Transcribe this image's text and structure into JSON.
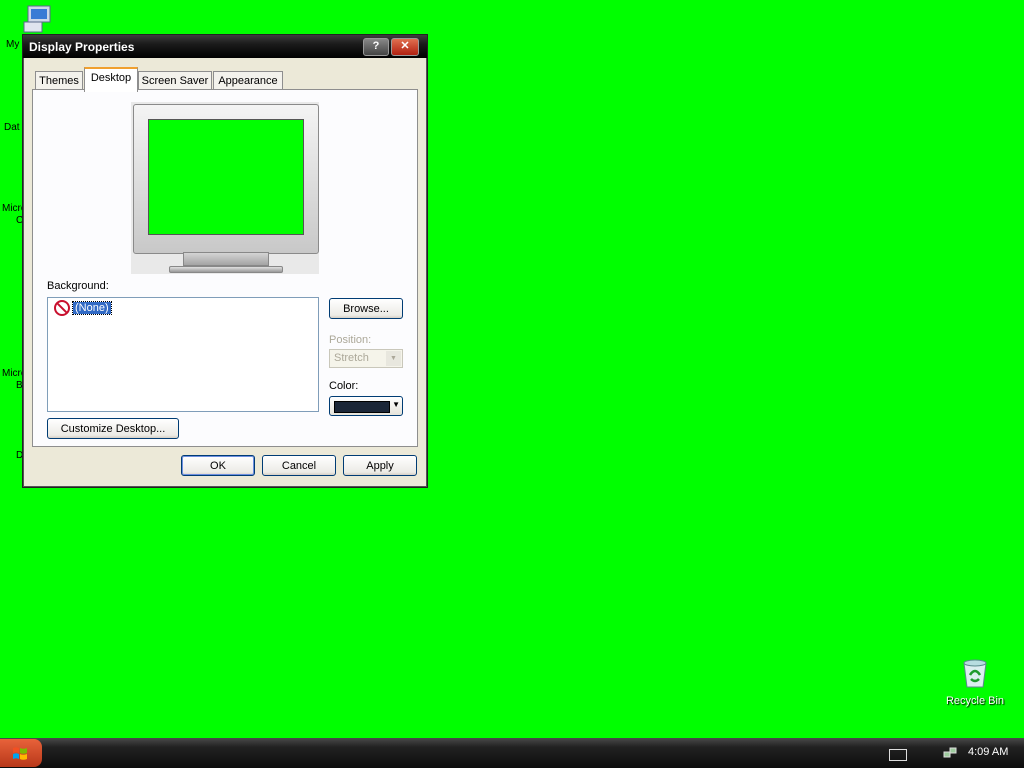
{
  "colors": {
    "desktop_bg": "#00ff00",
    "accent": "#316ac5",
    "swatch": "#1b2637"
  },
  "desktop": {
    "icon_fragments": [
      {
        "id": "my",
        "text": "My"
      },
      {
        "id": "dat",
        "text": "Dat"
      },
      {
        "id": "micr1",
        "text": "Micro"
      },
      {
        "id": "micr1b",
        "text": "C"
      },
      {
        "id": "micr2",
        "text": "Micro"
      },
      {
        "id": "micr2b",
        "text": "B"
      },
      {
        "id": "d",
        "text": "D"
      }
    ],
    "recycle_bin_label": "Recycle Bin"
  },
  "dialog": {
    "title": "Display Properties",
    "help_label": "?",
    "close_label": "✕",
    "tabs": [
      {
        "label": "Themes",
        "active": false
      },
      {
        "label": "Desktop",
        "active": true
      },
      {
        "label": "Screen Saver",
        "active": false
      },
      {
        "label": "Appearance",
        "active": false
      }
    ],
    "background_label": "Background:",
    "background_items": [
      {
        "label": "(None)",
        "icon": "no-entry-icon",
        "selected": true
      }
    ],
    "browse_label": "Browse...",
    "position_label": "Position:",
    "position_value": "Stretch",
    "color_label": "Color:",
    "customize_label": "Customize Desktop...",
    "ok_label": "OK",
    "cancel_label": "Cancel",
    "apply_label": "Apply"
  },
  "taskbar": {
    "start_icon": "windows-flag-icon",
    "clock": "4:09 AM"
  }
}
